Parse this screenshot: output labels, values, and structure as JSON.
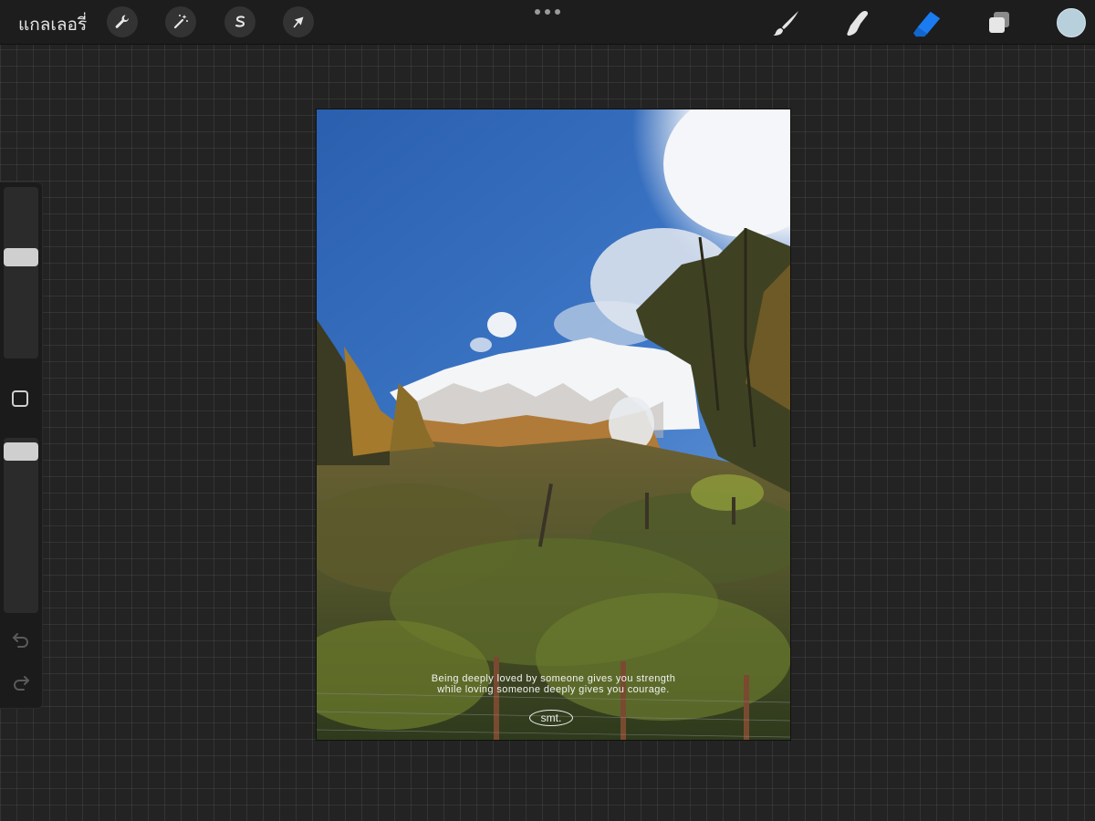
{
  "topbar": {
    "gallery_label": "แกลเลอรี่",
    "left_tools": [
      {
        "name": "actions",
        "icon": "wrench-icon"
      },
      {
        "name": "adjustments",
        "icon": "magic-wand-icon"
      },
      {
        "name": "selection",
        "icon": "selection-s-icon"
      },
      {
        "name": "transform",
        "icon": "arrow-cursor-icon"
      }
    ],
    "more_icon": "more-dots-icon",
    "right_tools": [
      {
        "name": "brush",
        "icon": "brush-icon",
        "active": false
      },
      {
        "name": "smudge",
        "icon": "smudge-finger-icon",
        "active": false
      },
      {
        "name": "eraser",
        "icon": "eraser-icon",
        "active": true
      },
      {
        "name": "layers",
        "icon": "layers-icon",
        "active": false
      }
    ],
    "color": "#b8cfdc"
  },
  "sidebar": {
    "brush_size": 0.6,
    "opacity": 1.0,
    "modify_icon": "square-icon",
    "undo_icon": "undo-icon",
    "redo_icon": "redo-icon"
  },
  "canvas": {
    "quote_line1": "Being deeply loved by someone gives you strength",
    "quote_line2": "while loving someone deeply gives you courage.",
    "signature": "smt."
  },
  "colors": {
    "accent": "#1a7cf0",
    "background": "#232323"
  }
}
